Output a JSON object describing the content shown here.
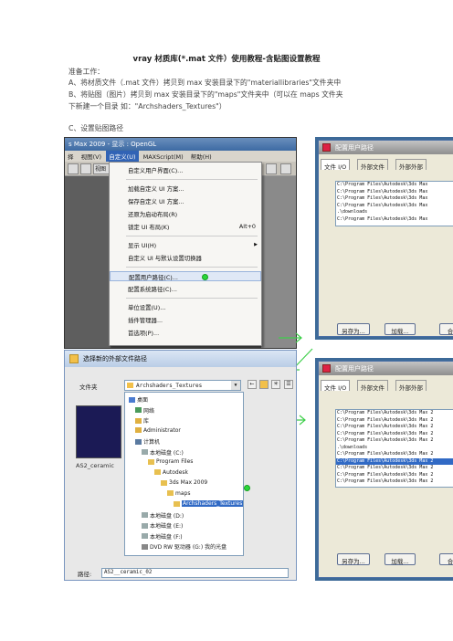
{
  "doc": {
    "title": "vray 材质库(*.mat 文件）使用教程-含贴图设置教程",
    "prep": "准备工作：",
    "step_a": "A、将材质文件（.mat 文件）拷贝到 max 安装目录下的\"materiallibraries\"文件夹中",
    "step_b1": "B、将贴图（图片）拷贝到 max 安装目录下的\"maps\"文件夹中（可以在 maps 文件夹",
    "step_b2": "下新建一个目录  如：\"Archshaders_Textures\"）",
    "step_c": "C、设置贴图路径"
  },
  "shot1": {
    "title": "s Max  2009    - 显示 : OpenGL",
    "menus": [
      "择",
      "视图(V)",
      "自定义(U)",
      "MAXScript(M)",
      "帮助(H)"
    ],
    "active_menu_index": 2,
    "view_btn": "视图",
    "items": [
      {
        "label": "自定义用户界面(C)...",
        "shortcut": "",
        "submenu": false,
        "highlight": false
      },
      {
        "label": "加载自定义 UI 方案...",
        "shortcut": "",
        "submenu": false,
        "highlight": false
      },
      {
        "label": "保存自定义 UI 方案...",
        "shortcut": "",
        "submenu": false,
        "highlight": false
      },
      {
        "label": "还原为启动布局(R)",
        "shortcut": "",
        "submenu": false,
        "highlight": false
      },
      {
        "label": "锁定 UI 布局(K)",
        "shortcut": "Alt+0",
        "submenu": false,
        "highlight": false
      },
      {
        "label": "显示 UI(H)",
        "shortcut": "",
        "submenu": true,
        "highlight": false
      },
      {
        "label": "自定义 UI 与默认设置切换器",
        "shortcut": "",
        "submenu": false,
        "highlight": false
      },
      {
        "label": "配置用户路径(C)...",
        "shortcut": "",
        "submenu": false,
        "highlight": true
      },
      {
        "label": "配置系统路径(C)...",
        "shortcut": "",
        "submenu": false,
        "highlight": false
      },
      {
        "label": "单位设置(U)...",
        "shortcut": "",
        "submenu": false,
        "highlight": false
      },
      {
        "label": "插件管理器...",
        "shortcut": "",
        "submenu": false,
        "highlight": false
      },
      {
        "label": "首选项(P)...",
        "shortcut": "",
        "submenu": false,
        "highlight": false
      }
    ]
  },
  "shot2": {
    "title": "配置用户路径",
    "tabs": [
      "文件 I/O",
      "外部文件",
      "外部外部"
    ],
    "paths": [
      "C:\\Program Files\\Autodesk\\3ds Max",
      "C:\\Program Files\\Autodesk\\3ds Max",
      "C:\\Program Files\\Autodesk\\3ds Max",
      "C:\\Program Files\\Autodesk\\3ds Max",
      ".\\downloads",
      "C:\\Program Files\\Autodesk\\3ds Max"
    ],
    "buttons": [
      "另存为...",
      "加载...",
      "合"
    ]
  },
  "shot3": {
    "title": "选择新的外部文件路径",
    "folder_label": "文件夹",
    "folder_value": "Archshaders_Textures",
    "preview_label": "AS2_ceramic",
    "path_label": "路径:",
    "path_value": "AS2__ceramic_02",
    "tree": [
      {
        "label": "桌面",
        "indent": 0,
        "icon": "#4a7bd0",
        "selected": false
      },
      {
        "label": "网络",
        "indent": 1,
        "icon": "#4a9a5a",
        "selected": false
      },
      {
        "label": "库",
        "indent": 1,
        "icon": "#e0b040",
        "selected": false
      },
      {
        "label": "Administrator",
        "indent": 1,
        "icon": "#e0b040",
        "selected": false
      },
      {
        "label": "计算机",
        "indent": 1,
        "icon": "#5a7aa0",
        "selected": false
      },
      {
        "label": "本地磁盘 (C:)",
        "indent": 2,
        "icon": "#9aa",
        "selected": false
      },
      {
        "label": "Program Files",
        "indent": 3,
        "icon": "#e8c050",
        "selected": false
      },
      {
        "label": "Autodesk",
        "indent": 4,
        "icon": "#e8c050",
        "selected": false
      },
      {
        "label": "3ds Max 2009",
        "indent": 5,
        "icon": "#e8c050",
        "selected": false
      },
      {
        "label": "maps",
        "indent": 6,
        "icon": "#e8c050",
        "selected": false
      },
      {
        "label": "Archshaders_Textures",
        "indent": 7,
        "icon": "#e8c050",
        "selected": true
      },
      {
        "label": "本地磁盘 (D:)",
        "indent": 2,
        "icon": "#9aa",
        "selected": false
      },
      {
        "label": "本地磁盘 (E:)",
        "indent": 2,
        "icon": "#9aa",
        "selected": false
      },
      {
        "label": "本地磁盘 (F:)",
        "indent": 2,
        "icon": "#9aa",
        "selected": false
      },
      {
        "label": "DVD RW 驱动器 (G:) 我的光盘",
        "indent": 2,
        "icon": "#888",
        "selected": false
      }
    ]
  },
  "shot4": {
    "title": "配置用户路径",
    "tabs": [
      "文件 I/O",
      "外部文件",
      "外部外部"
    ],
    "paths": [
      "C:\\Program Files\\Autodesk\\3ds Max 2",
      "C:\\Program Files\\Autodesk\\3ds Max 2",
      "C:\\Program Files\\Autodesk\\3ds Max 2",
      "C:\\Program Files\\Autodesk\\3ds Max 2",
      "C:\\Program Files\\Autodesk\\3ds Max 2",
      ".\\downloads",
      "C:\\Program Files\\Autodesk\\3ds Max 2",
      "C:\\Program Files\\Autodesk\\3ds Max 2",
      "C:\\Program Files\\Autodesk\\3ds Max 2",
      "C:\\Program Files\\Autodesk\\3ds Max 2",
      "C:\\Program Files\\Autodesk\\3ds Max 2"
    ],
    "selected_path_index": 7,
    "buttons": [
      "另存为...",
      "加载...",
      "合"
    ]
  },
  "colors": {
    "highlight_dot": "#2ad63a",
    "arrow": "#3ecf4a",
    "selection": "#316ac5"
  }
}
